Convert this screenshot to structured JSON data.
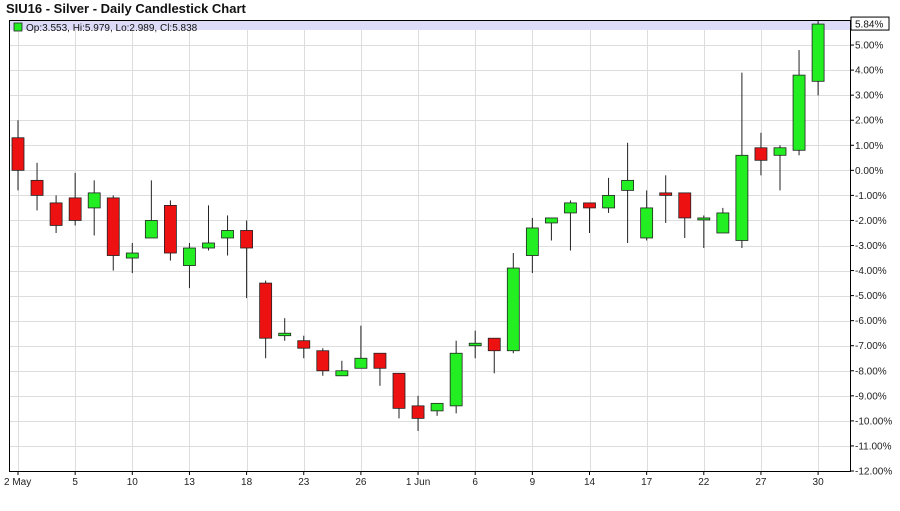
{
  "title": "SIU16 - Silver - Daily Candlestick Chart",
  "legend": "Op:3.553, Hi:5.979, Lo:2.989, Cl:5.838",
  "last_value_label": "5.84%",
  "colors": {
    "up": "#22ee22",
    "down": "#ee1111",
    "grid": "#dddddd",
    "legend_band": "#dcdcf8",
    "wick": "#222222"
  },
  "chart_data": {
    "type": "candlestick",
    "ylim": [
      -12,
      6
    ],
    "y_ticks": [
      "5.00%",
      "4.00%",
      "3.00%",
      "2.00%",
      "1.00%",
      "0.00%",
      "-1.00%",
      "-2.00%",
      "-3.00%",
      "-4.00%",
      "-5.00%",
      "-6.00%",
      "-7.00%",
      "-8.00%",
      "-9.00%",
      "-10.00%",
      "-11.00%",
      "-12.00%"
    ],
    "x_ticks": [
      {
        "label": "2 May",
        "index": 0
      },
      {
        "label": "5",
        "index": 3
      },
      {
        "label": "10",
        "index": 6
      },
      {
        "label": "13",
        "index": 9
      },
      {
        "label": "18",
        "index": 12
      },
      {
        "label": "23",
        "index": 15
      },
      {
        "label": "26",
        "index": 18
      },
      {
        "label": "1 Jun",
        "index": 21
      },
      {
        "label": "6",
        "index": 24
      },
      {
        "label": "9",
        "index": 27
      },
      {
        "label": "14",
        "index": 30
      },
      {
        "label": "17",
        "index": 33
      },
      {
        "label": "22",
        "index": 36
      },
      {
        "label": "27",
        "index": 39
      },
      {
        "label": "30",
        "index": 42
      }
    ],
    "candles": [
      {
        "open": 1.3,
        "high": 2.0,
        "low": -0.8,
        "close": 0.0
      },
      {
        "open": -0.4,
        "high": 0.3,
        "low": -1.6,
        "close": -1.0
      },
      {
        "open": -1.3,
        "high": -1.0,
        "low": -2.5,
        "close": -2.2
      },
      {
        "open": -1.1,
        "high": -0.1,
        "low": -2.2,
        "close": -2.0
      },
      {
        "open": -1.5,
        "high": -0.4,
        "low": -2.6,
        "close": -0.9
      },
      {
        "open": -1.1,
        "high": -1.0,
        "low": -4.0,
        "close": -3.4
      },
      {
        "open": -3.5,
        "high": -2.9,
        "low": -4.1,
        "close": -3.3
      },
      {
        "open": -2.7,
        "high": -0.4,
        "low": -2.7,
        "close": -2.0
      },
      {
        "open": -1.4,
        "high": -1.2,
        "low": -3.6,
        "close": -3.3
      },
      {
        "open": -3.8,
        "high": -2.9,
        "low": -4.7,
        "close": -3.1
      },
      {
        "open": -3.1,
        "high": -1.4,
        "low": -3.2,
        "close": -2.9
      },
      {
        "open": -2.7,
        "high": -1.8,
        "low": -3.4,
        "close": -2.4
      },
      {
        "open": -2.4,
        "high": -2.0,
        "low": -5.1,
        "close": -3.1
      },
      {
        "open": -4.5,
        "high": -4.4,
        "low": -7.5,
        "close": -6.7
      },
      {
        "open": -6.6,
        "high": -5.9,
        "low": -6.8,
        "close": -6.5
      },
      {
        "open": -6.8,
        "high": -6.6,
        "low": -7.5,
        "close": -7.1
      },
      {
        "open": -7.2,
        "high": -7.1,
        "low": -8.2,
        "close": -8.0
      },
      {
        "open": -8.2,
        "high": -7.6,
        "low": -8.2,
        "close": -8.0
      },
      {
        "open": -7.9,
        "high": -6.2,
        "low": -7.9,
        "close": -7.5
      },
      {
        "open": -7.3,
        "high": -7.3,
        "low": -8.6,
        "close": -7.9
      },
      {
        "open": -8.1,
        "high": -8.1,
        "low": -9.9,
        "close": -9.5
      },
      {
        "open": -9.4,
        "high": -9.0,
        "low": -10.4,
        "close": -9.9
      },
      {
        "open": -9.6,
        "high": -9.3,
        "low": -9.8,
        "close": -9.3
      },
      {
        "open": -9.4,
        "high": -6.8,
        "low": -9.7,
        "close": -7.3
      },
      {
        "open": -7.0,
        "high": -6.4,
        "low": -7.5,
        "close": -6.9
      },
      {
        "open": -6.7,
        "high": -6.7,
        "low": -8.1,
        "close": -7.2
      },
      {
        "open": -7.2,
        "high": -3.3,
        "low": -7.3,
        "close": -3.9
      },
      {
        "open": -3.4,
        "high": -1.9,
        "low": -4.1,
        "close": -2.3
      },
      {
        "open": -2.1,
        "high": -1.9,
        "low": -2.8,
        "close": -1.9
      },
      {
        "open": -1.7,
        "high": -1.2,
        "low": -3.2,
        "close": -1.3
      },
      {
        "open": -1.3,
        "high": -1.3,
        "low": -2.5,
        "close": -1.5
      },
      {
        "open": -1.5,
        "high": -0.3,
        "low": -1.7,
        "close": -1.0
      },
      {
        "open": -0.8,
        "high": 1.1,
        "low": -2.9,
        "close": -0.4
      },
      {
        "open": -2.7,
        "high": -0.8,
        "low": -2.8,
        "close": -1.5
      },
      {
        "open": -0.9,
        "high": -0.2,
        "low": -2.1,
        "close": -1.0
      },
      {
        "open": -0.9,
        "high": -0.9,
        "low": -2.7,
        "close": -1.9
      },
      {
        "open": -1.9,
        "high": -1.8,
        "low": -3.1,
        "close": -1.9
      },
      {
        "open": -2.5,
        "high": -1.5,
        "low": -2.5,
        "close": -1.7
      },
      {
        "open": -2.8,
        "high": 3.9,
        "low": -3.1,
        "close": 0.6
      },
      {
        "open": 0.9,
        "high": 1.5,
        "low": -0.2,
        "close": 0.4
      },
      {
        "open": 0.6,
        "high": 1.0,
        "low": -0.8,
        "close": 0.9
      },
      {
        "open": 0.8,
        "high": 4.8,
        "low": 0.6,
        "close": 3.8
      },
      {
        "open": 3.553,
        "high": 5.979,
        "low": 2.989,
        "close": 5.838
      }
    ]
  }
}
